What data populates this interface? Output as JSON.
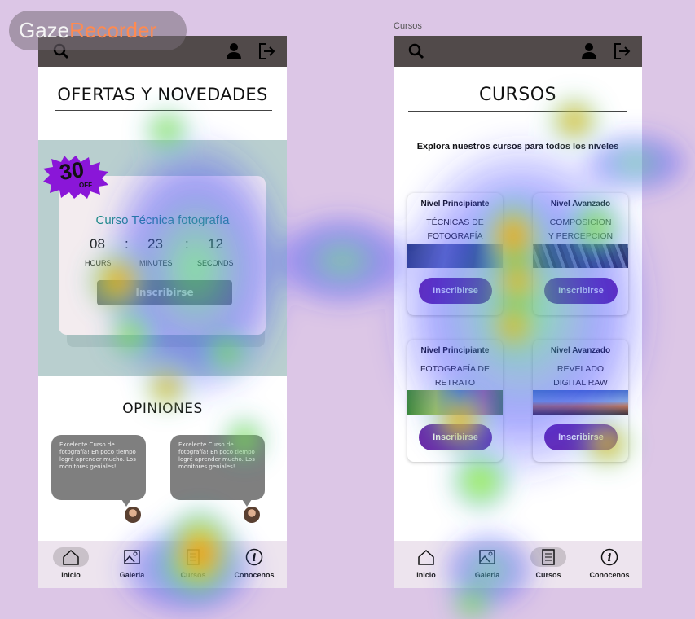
{
  "logo": {
    "part1": "Gaze",
    "part2": "Recorder"
  },
  "screen_label": "Cursos",
  "left": {
    "title": "OFERTAS Y NOVEDADES",
    "badge": {
      "big": "30",
      "small": "OFF"
    },
    "course_title": "Curso Técnica fotografía",
    "countdown": {
      "hours": "08",
      "minutes": "23",
      "seconds": "12",
      "sep": ":",
      "hours_label": "HOURS",
      "minutes_label": "MINUTES",
      "seconds_label": "SECONDS"
    },
    "enroll_label": "Inscribirse",
    "opinions_title": "OPINIONES",
    "reviews": [
      "Excelente Curso de fotografía! En poco tiempo logré aprender mucho. Los monitores geniales!",
      "Excelente Curso de fotografía! En poco tiempo logré aprender mucho. Los monitores geniales!"
    ],
    "nav": [
      "Inicio",
      "Galeria",
      "Cursos",
      "Conocenos"
    ],
    "nav_active": 0
  },
  "right": {
    "title": "CURSOS",
    "subtitle": "Explora nuestros cursos  para todos los niveles",
    "courses": [
      {
        "level": "Nivel Principiante",
        "line1": "TÉCNICAS DE",
        "line2": "FOTOGRAFÍA",
        "button": "Inscribirse"
      },
      {
        "level": "Nivel Avanzado",
        "line1": "COMPOSICION",
        "line2": "Y PERCEPCION",
        "button": "Inscribirse"
      },
      {
        "level": "Nivel Principiante",
        "line1": "FOTOGRAFÍA DE",
        "line2": "RETRATO",
        "button": "Inscribirse"
      },
      {
        "level": "Nivel Avanzado",
        "line1": "REVELADO",
        "line2": "DIGITAL RAW",
        "button": "Inscribirse"
      }
    ],
    "nav": [
      "Inicio",
      "Galeria",
      "Cursos",
      "Conocenos"
    ],
    "nav_active": 2
  },
  "colors": {
    "accent_purple": "#6c2aa8",
    "badge_purple": "#8a16d8",
    "teal_text": "#1f8d86",
    "topbar": "#514a4a"
  }
}
